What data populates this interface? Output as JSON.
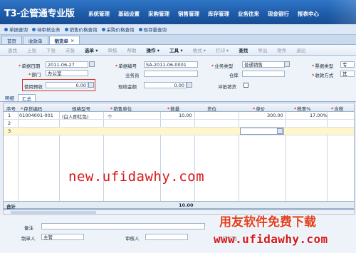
{
  "app": {
    "title": "T3-企管通专业版",
    "logo_prefix": "T3"
  },
  "topnav": [
    "系统管理",
    "基础设置",
    "采购管理",
    "销售管理",
    "库存管理",
    "业务往来",
    "现金银行",
    "报表中心"
  ],
  "quicklinks": [
    "单据查询",
    "待审核业务",
    "销售价格查询",
    "采购价格查询",
    "现存量查询"
  ],
  "tabs": [
    {
      "label": "首页"
    },
    {
      "label": "收款单"
    },
    {
      "label": "销货单",
      "active": true
    }
  ],
  "toolbar": [
    {
      "label": "查找",
      "enabled": false
    },
    {
      "label": "上张",
      "enabled": false
    },
    {
      "label": "下张",
      "enabled": false
    },
    {
      "label": "末张",
      "enabled": false
    },
    {
      "label": "选单 ▾",
      "enabled": true
    },
    {
      "label": "审核",
      "enabled": false
    },
    {
      "label": "帮助",
      "enabled": false
    },
    {
      "label": "操作 ▾",
      "enabled": true
    },
    {
      "label": "工具 ▾",
      "enabled": true
    },
    {
      "label": "格式 ▾",
      "enabled": false
    },
    {
      "label": "打印 ▾",
      "enabled": false
    },
    {
      "label": "查找",
      "enabled": true
    },
    {
      "label": "导出",
      "enabled": false
    },
    {
      "label": "附件",
      "enabled": false
    },
    {
      "label": "退出",
      "enabled": false
    }
  ],
  "form": {
    "date_label": "单据日期",
    "date_value": "2011-06-27",
    "number_label": "单据编号",
    "number_value": "SA-2011-06-0001",
    "biztype_label": "业务类型",
    "biztype_value": "普通销售",
    "invtype_label": "票据类型",
    "invtype_value": "专",
    "dept_label": "部门",
    "dept_value": "办公室",
    "salesman_label": "业务员",
    "warehouse_label": "仓库",
    "payment_label": "收款方式",
    "payment_value": "其",
    "prepay_label": "使用预收",
    "prepay_value": "0.00",
    "spec_amount_label": "现结金额",
    "spec_amount_value": "0.00",
    "writeoff_label": "冲抵销货"
  },
  "subtabs": [
    "明细",
    "汇总"
  ],
  "grid": {
    "headers": [
      "序号",
      "存货编码",
      "规格型号",
      "销售单位",
      "数量",
      "货位",
      "单价",
      "税率%",
      "含税"
    ],
    "rows": [
      {
        "no": "1",
        "code": "01004001-001",
        "spec": "(白人即红色)",
        "unit": "个",
        "qty": "10.00",
        "price": "300.00",
        "tax": "17.00%"
      },
      {
        "no": "2",
        "code": "",
        "spec": "",
        "unit": "",
        "qty": "",
        "price": "",
        "tax": ""
      },
      {
        "no": "3",
        "code": "",
        "spec": "",
        "unit": "",
        "qty": "",
        "price": "",
        "tax": ""
      }
    ],
    "total_label": "合计",
    "total_qty": "10.00"
  },
  "watermark": "new.ufidawhy.com",
  "footer": {
    "remark_label": "备注",
    "maker_label": "制单人",
    "maker_value": "主管",
    "auditor_label": "审核人",
    "audit_date_label": "审核日期"
  },
  "brand": {
    "cn": "用友软件免费下载",
    "url": "www.ufidawhy.com"
  }
}
